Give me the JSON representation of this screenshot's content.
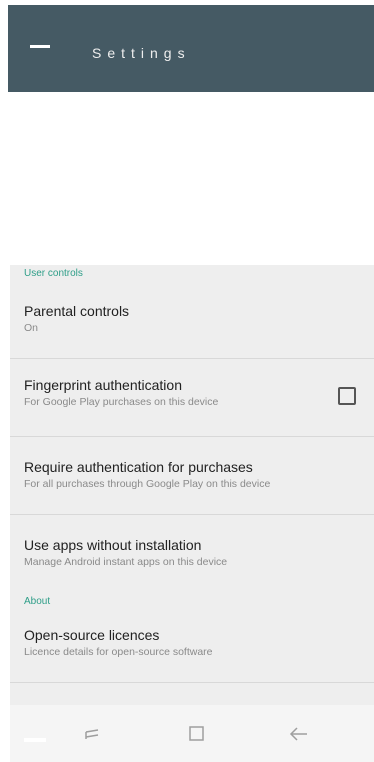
{
  "toolbar": {
    "title": "Settings",
    "background": "#455a64"
  },
  "sections": {
    "user_controls": "User controls",
    "about": "About"
  },
  "rows": {
    "parental": {
      "title": "Parental controls",
      "subtitle": "On"
    },
    "fingerprint": {
      "title": "Fingerprint authentication",
      "subtitle": "For Google Play purchases on this device",
      "checked": false
    },
    "purchase": {
      "title": "Require authentication for purchases",
      "subtitle": "For all purchases through Google Play on this device"
    },
    "instant": {
      "title": "Use apps without installation",
      "subtitle": "Manage Android instant apps on this device"
    },
    "oss": {
      "title": "Open-source licences",
      "subtitle": "Licence details for open-source software"
    }
  },
  "colors": {
    "accent": "#2e9e88",
    "list_background": "#eeeeee",
    "divider": "#d8d8d8"
  },
  "icons": {
    "menu": "hamburger-menu-icon",
    "recents": "recent-apps-icon",
    "home": "home-square-icon",
    "back": "back-arrow-icon"
  }
}
